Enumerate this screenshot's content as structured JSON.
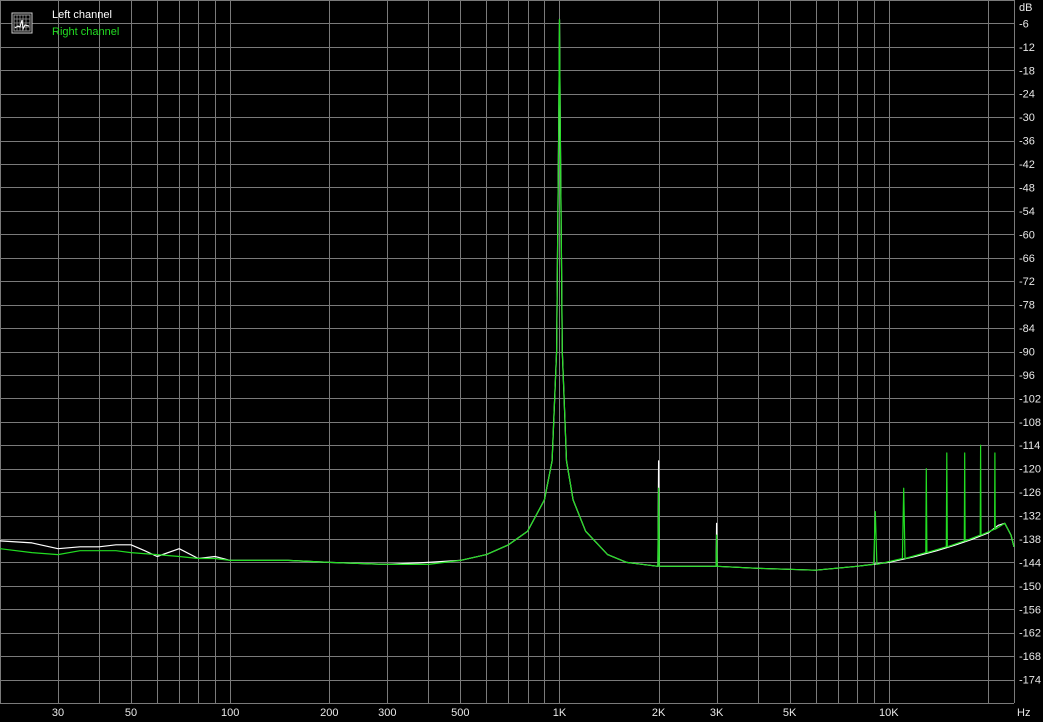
{
  "chart_data": {
    "type": "line",
    "title": "",
    "x_unit": "Hz",
    "y_unit": "dB",
    "x_scale": "log",
    "xlim": [
      20,
      24000
    ],
    "ylim": [
      -180,
      0
    ],
    "grid": true,
    "background": "#000000",
    "grid_color": "#7a7a7a",
    "legend_position": "top-left",
    "legend_icon": "spectrum-grid-icon",
    "y_ticks": [
      -6,
      -12,
      -18,
      -24,
      -30,
      -36,
      -42,
      -48,
      -54,
      -60,
      -66,
      -72,
      -78,
      -84,
      -90,
      -96,
      -102,
      -108,
      -114,
      -120,
      -126,
      -132,
      -138,
      -144,
      -150,
      -156,
      -162,
      -168,
      -174
    ],
    "y_tick_labels": [
      "-6",
      "-12",
      "-18",
      "-24",
      "-30",
      "-36",
      "-42",
      "-48",
      "-54",
      "-60",
      "-66",
      "-72",
      "-78",
      "-84",
      "-90",
      "-96",
      "-102",
      "-108",
      "-114",
      "-120",
      "-126",
      "-132",
      "-138",
      "-144",
      "-150",
      "-156",
      "-162",
      "-168",
      "-174"
    ],
    "x_ticks": [
      30,
      50,
      100,
      200,
      300,
      500,
      1000,
      2000,
      3000,
      5000,
      10000
    ],
    "x_tick_labels": [
      "30",
      "50",
      "100",
      "200",
      "300",
      "500",
      "1K",
      "2K",
      "3K",
      "5K",
      "10K"
    ],
    "series": [
      {
        "name": "Left channel",
        "color": "#ffffff",
        "points": [
          [
            20,
            -138.5
          ],
          [
            25,
            -139
          ],
          [
            30,
            -140.5
          ],
          [
            35,
            -140
          ],
          [
            40,
            -140
          ],
          [
            45,
            -139.5
          ],
          [
            50,
            -139.5
          ],
          [
            55,
            -141
          ],
          [
            60,
            -142.5
          ],
          [
            70,
            -140.5
          ],
          [
            80,
            -143
          ],
          [
            90,
            -142.5
          ],
          [
            100,
            -143.5
          ],
          [
            150,
            -143.5
          ],
          [
            200,
            -144
          ],
          [
            300,
            -144.5
          ],
          [
            400,
            -144
          ],
          [
            500,
            -143.5
          ],
          [
            600,
            -142
          ],
          [
            700,
            -139.5
          ],
          [
            800,
            -136
          ],
          [
            900,
            -128
          ],
          [
            950,
            -118
          ],
          [
            980,
            -90
          ],
          [
            995,
            -30
          ],
          [
            1000,
            -5
          ],
          [
            1005,
            -30
          ],
          [
            1020,
            -90
          ],
          [
            1050,
            -118
          ],
          [
            1100,
            -128
          ],
          [
            1200,
            -136
          ],
          [
            1400,
            -142
          ],
          [
            1600,
            -144
          ],
          [
            1990,
            -145
          ],
          [
            2000,
            -118
          ],
          [
            2010,
            -145
          ],
          [
            2990,
            -145
          ],
          [
            3000,
            -134
          ],
          [
            3010,
            -145
          ],
          [
            4000,
            -145.5
          ],
          [
            6000,
            -146
          ],
          [
            8000,
            -145
          ],
          [
            10000,
            -144
          ],
          [
            12000,
            -142.5
          ],
          [
            14000,
            -141
          ],
          [
            16000,
            -139.5
          ],
          [
            18000,
            -138
          ],
          [
            20000,
            -136.5
          ],
          [
            21500,
            -134.5
          ],
          [
            22500,
            -134
          ],
          [
            23500,
            -137
          ],
          [
            24000,
            -140
          ]
        ]
      },
      {
        "name": "Right channel",
        "color": "#22dd22",
        "points": [
          [
            20,
            -140.5
          ],
          [
            25,
            -141.5
          ],
          [
            30,
            -142
          ],
          [
            35,
            -141
          ],
          [
            40,
            -141
          ],
          [
            45,
            -141
          ],
          [
            50,
            -141.5
          ],
          [
            60,
            -142
          ],
          [
            70,
            -142.5
          ],
          [
            80,
            -143
          ],
          [
            90,
            -143
          ],
          [
            100,
            -143.5
          ],
          [
            150,
            -143.5
          ],
          [
            200,
            -144
          ],
          [
            300,
            -144.5
          ],
          [
            400,
            -144.5
          ],
          [
            500,
            -143.5
          ],
          [
            600,
            -142
          ],
          [
            700,
            -139.5
          ],
          [
            800,
            -136
          ],
          [
            900,
            -128
          ],
          [
            950,
            -118
          ],
          [
            980,
            -90
          ],
          [
            995,
            -30
          ],
          [
            1000,
            -5
          ],
          [
            1005,
            -30
          ],
          [
            1020,
            -90
          ],
          [
            1050,
            -118
          ],
          [
            1100,
            -128
          ],
          [
            1200,
            -136
          ],
          [
            1400,
            -142
          ],
          [
            1600,
            -144
          ],
          [
            1990,
            -145
          ],
          [
            2000,
            -125
          ],
          [
            2010,
            -145
          ],
          [
            2990,
            -145
          ],
          [
            3000,
            -137
          ],
          [
            3010,
            -145
          ],
          [
            4000,
            -145.5
          ],
          [
            6000,
            -146
          ],
          [
            8000,
            -145
          ],
          [
            9000,
            -144.5
          ],
          [
            9100,
            -131
          ],
          [
            9200,
            -144.5
          ],
          [
            11000,
            -143
          ],
          [
            11100,
            -125
          ],
          [
            11200,
            -143
          ],
          [
            12950,
            -141.5
          ],
          [
            13000,
            -120
          ],
          [
            13050,
            -141.5
          ],
          [
            14950,
            -140
          ],
          [
            15000,
            -116
          ],
          [
            15050,
            -140
          ],
          [
            16950,
            -138.5
          ],
          [
            17000,
            -116
          ],
          [
            17050,
            -138.5
          ],
          [
            18950,
            -137
          ],
          [
            19000,
            -114
          ],
          [
            19050,
            -137
          ],
          [
            20950,
            -135.5
          ],
          [
            21000,
            -116
          ],
          [
            21050,
            -135.5
          ],
          [
            22500,
            -134
          ],
          [
            23500,
            -137
          ],
          [
            24000,
            -140
          ]
        ]
      }
    ]
  },
  "legend": {
    "left_label": "Left channel",
    "right_label": "Right channel"
  },
  "axis": {
    "y_unit_label": "dB",
    "x_unit_label": "Hz"
  }
}
